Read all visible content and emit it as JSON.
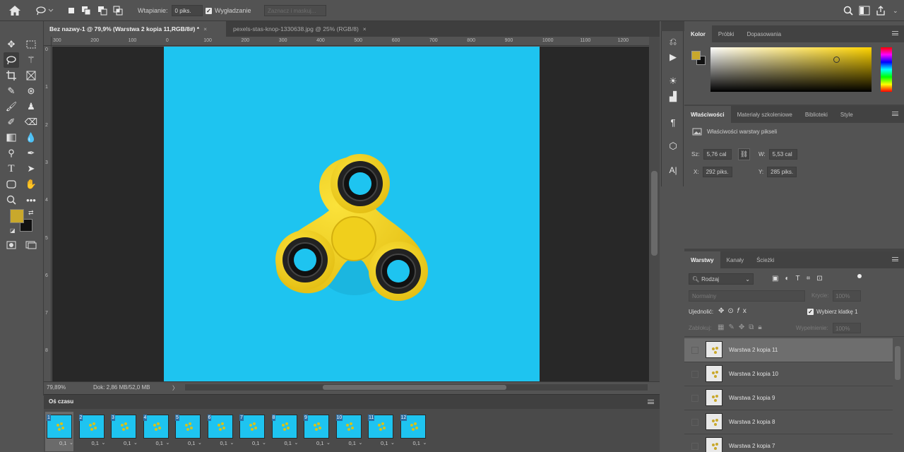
{
  "options_bar": {
    "feather_label": "Wtapianie:",
    "feather_value": "0 piks.",
    "antialias_label": "Wygładzanie",
    "select_mask_label": "Zaznacz i maskuj..."
  },
  "document_tabs": [
    {
      "label": "Bez nazwy-1 @ 79,9% (Warstwa 2 kopia 11,RGB/8#) *",
      "close": "×",
      "active": true
    },
    {
      "label": "pexels-stas-knop-1330638.jpg @ 25% (RGB/8)",
      "close": "×",
      "active": false
    }
  ],
  "ruler": {
    "h_ticks": [
      "300",
      "200",
      "100",
      "0",
      "100",
      "200",
      "300",
      "400",
      "500",
      "600",
      "700",
      "800",
      "900",
      "1000",
      "1100",
      "1200"
    ],
    "v_ticks": [
      "0",
      "1",
      "2",
      "3",
      "4",
      "5",
      "6",
      "7",
      "8"
    ]
  },
  "status_bar": {
    "zoom": "79,89%",
    "doc": "Dok: 2,86 MB/52,0 MB",
    "arrow": "〉"
  },
  "timeline": {
    "title": "Oś czasu",
    "frames": [
      {
        "num": "1",
        "delay": "0,1"
      },
      {
        "num": "2",
        "delay": "0,1"
      },
      {
        "num": "3",
        "delay": "0,1"
      },
      {
        "num": "4",
        "delay": "0,1"
      },
      {
        "num": "5",
        "delay": "0,1"
      },
      {
        "num": "6",
        "delay": "0,1"
      },
      {
        "num": "7",
        "delay": "0,1"
      },
      {
        "num": "8",
        "delay": "0,1"
      },
      {
        "num": "9",
        "delay": "0,1"
      },
      {
        "num": "10",
        "delay": "0,1"
      },
      {
        "num": "11",
        "delay": "0,1"
      },
      {
        "num": "12",
        "delay": "0,1"
      }
    ]
  },
  "color_panel": {
    "tabs": [
      "Kolor",
      "Próbki",
      "Dopasowania"
    ],
    "foreground": "#c9a82c",
    "background": "#111111"
  },
  "properties_panel": {
    "tabs": [
      "Właściwości",
      "Materiały szkoleniowe",
      "Biblioteki",
      "Style"
    ],
    "heading": "Właściwości warstwy pikseli",
    "w_label": "Sz:",
    "w_value": "5,76 cal",
    "h_label": "W:",
    "h_value": "5,53 cal",
    "x_label": "X:",
    "x_value": "292 piks.",
    "y_label": "Y:",
    "y_value": "285 piks."
  },
  "layers_panel": {
    "tabs": [
      "Warstwy",
      "Kanały",
      "Ścieżki"
    ],
    "filter_label": "Rodzaj",
    "blend_mode": "Normalny",
    "opacity_label": "Krycie:",
    "opacity_value": "100%",
    "unify_label": "Ujednolić:",
    "propagate_label": "Wybierz klatkę 1",
    "lock_label": "Zablokuj:",
    "fill_label": "Wypełnienie:",
    "fill_value": "100%",
    "layers": [
      {
        "name": "Warstwa 2 kopia 11",
        "selected": true
      },
      {
        "name": "Warstwa 2 kopia 10",
        "selected": false
      },
      {
        "name": "Warstwa 2 kopia 9",
        "selected": false
      },
      {
        "name": "Warstwa 2 kopia 8",
        "selected": false
      },
      {
        "name": "Warstwa 2 kopia 7",
        "selected": false
      }
    ]
  },
  "colors": {
    "canvas_blue": "#1ec4f0",
    "spinner_yellow": "#f2d21b",
    "ui_gray": "#535353"
  }
}
